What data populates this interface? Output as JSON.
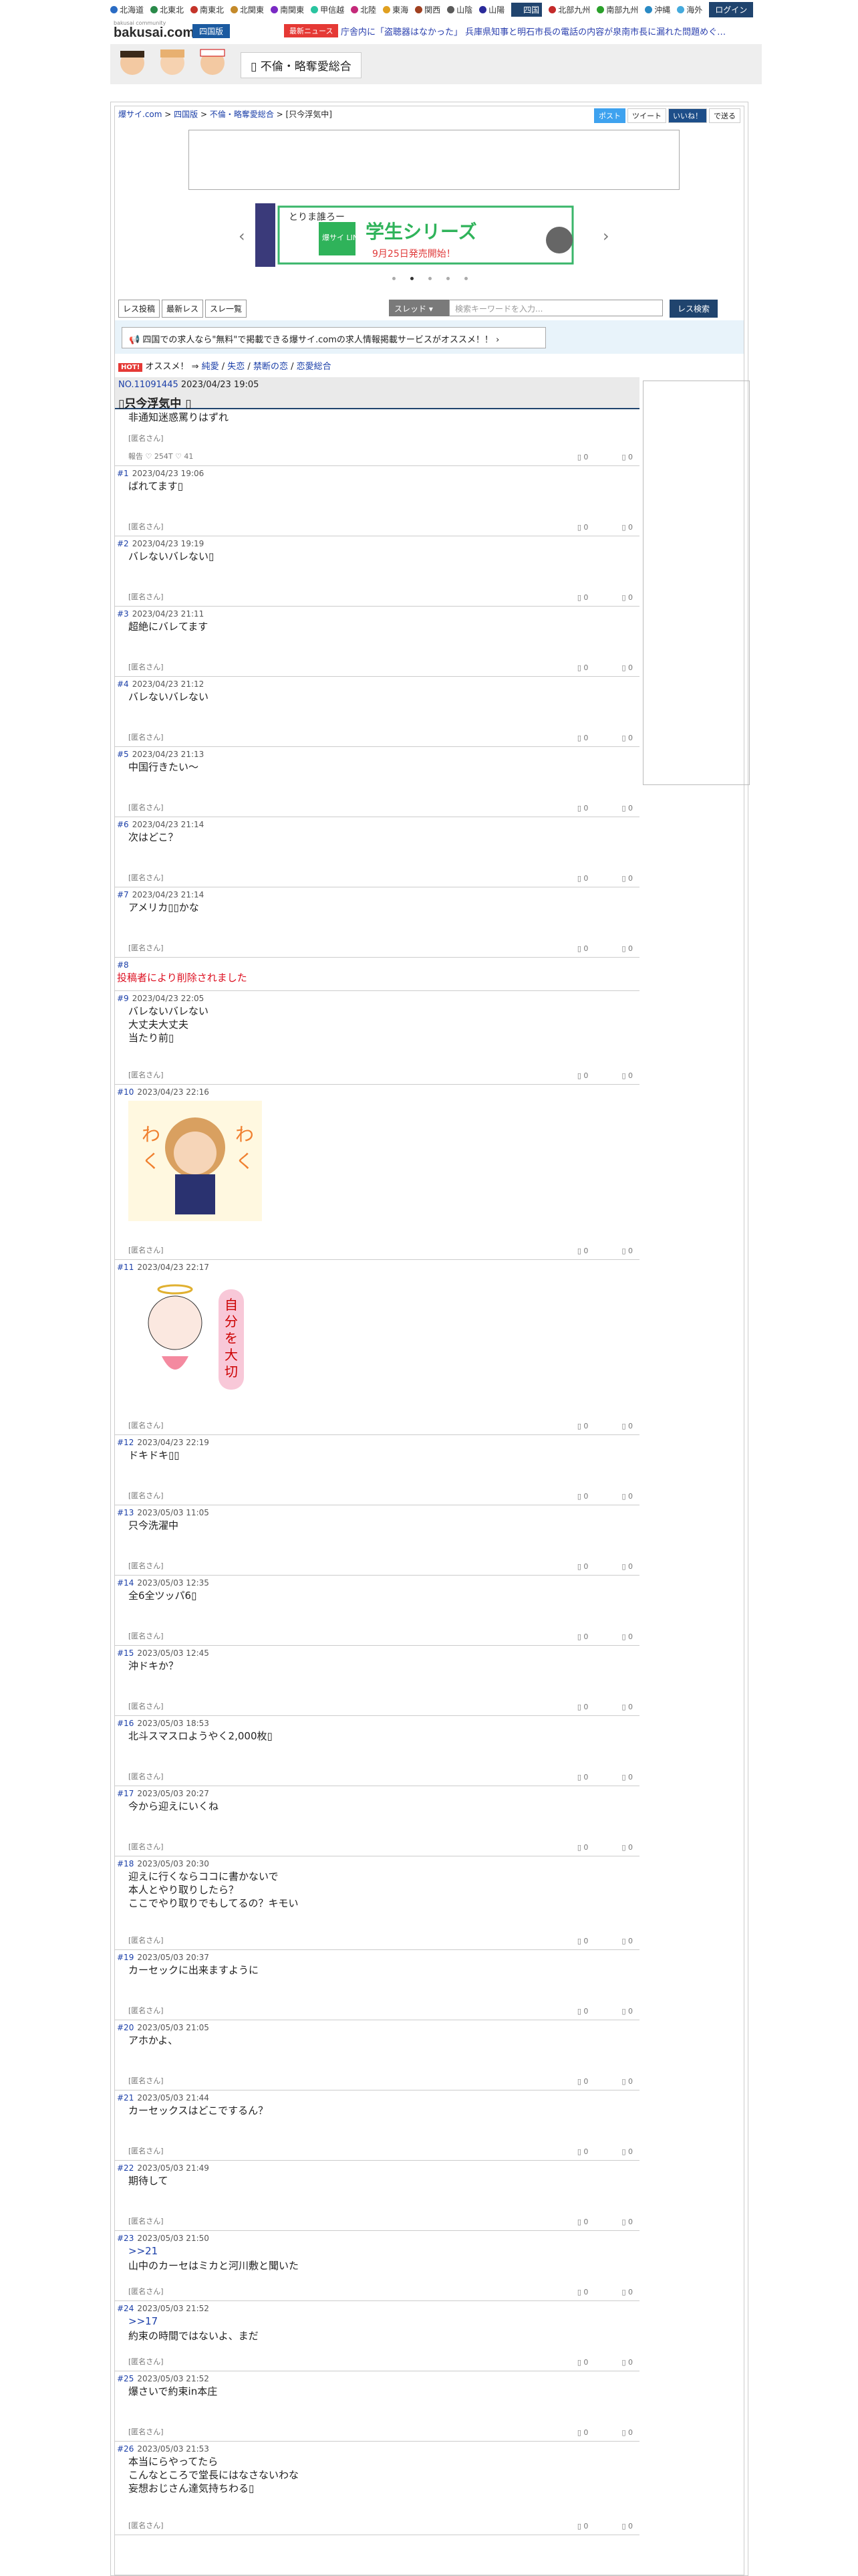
{
  "nav": {
    "regions": [
      "北海道",
      "北東北",
      "南東北",
      "北関東",
      "南関東",
      "甲信越",
      "北陸",
      "東海",
      "関西",
      "山陰",
      "山陽",
      "四国",
      "北部九州",
      "南部九州",
      "沖縄",
      "海外"
    ],
    "active_region": "四国",
    "login": "ログイン"
  },
  "header": {
    "logo_small": "bakusai community",
    "logo": "bakusai.com",
    "region_badge": "四国版",
    "news_badge": "最新ニュース",
    "ticker": "庁舎内に「盗聴器はなかった」 兵庫県知事と明石市長の電話の内容が泉南市長に漏れた問題めぐ…"
  },
  "category": {
    "title": "不倫・略奪愛総合"
  },
  "breadcrumb": {
    "b1": "爆サイ.com",
    "b2": "四国版",
    "b3": "不倫・略奪愛総合",
    "b4": "只今浮気中"
  },
  "share": {
    "twitter": "ポスト",
    "tweet": "ツイート",
    "line": "いいね！",
    "close": "で送る"
  },
  "banner": {
    "text_a": "とりま誰ろー",
    "text_b": "爆サイ LINE スタンプ",
    "text_c": "学生シリーズ",
    "text_d": "9月25日発売開始！"
  },
  "toolbar": {
    "post_reply": "レス投稿",
    "latest": "最新レス",
    "thread_list": "スレ一覧",
    "select": "スレッド",
    "search_placeholder": "検索キーワードを入力...",
    "search_btn": "レス検索"
  },
  "job_banner": "四国での求人なら\"無料\"で掲載できる爆サイ.comの求人情報掲載サービスがオススメ！！",
  "hot": {
    "badge": "HOT!",
    "label": "オススメ！",
    "arrow": "⇒",
    "links": [
      "純愛",
      "失恋",
      "禁断の恋",
      "恋愛総合"
    ]
  },
  "thread": {
    "no": "NO.11091445",
    "date": "2023/04/23 19:05",
    "title": "只今浮気中",
    "first_body": "非通知迷惑罵りはずれ",
    "first_author": "[匿名さん]",
    "first_stats": "報告  ♡ 254T  ♡ 41"
  },
  "posts": [
    {
      "n": "#1",
      "d": "2023/04/23 19:06",
      "b": "ばれてます▯",
      "a": "[匿名さん]"
    },
    {
      "n": "#2",
      "d": "2023/04/23 19:19",
      "b": "バレないバレない▯",
      "a": "[匿名さん]"
    },
    {
      "n": "#3",
      "d": "2023/04/23 21:11",
      "b": "超絶にバレてます",
      "a": "[匿名さん]"
    },
    {
      "n": "#4",
      "d": "2023/04/23 21:12",
      "b": "バレないバレない",
      "a": "[匿名さん]"
    },
    {
      "n": "#5",
      "d": "2023/04/23 21:13",
      "b": "中国行きたい〜",
      "a": "[匿名さん]"
    },
    {
      "n": "#6",
      "d": "2023/04/23 21:14",
      "b": "次はどこ？",
      "a": "[匿名さん]"
    },
    {
      "n": "#7",
      "d": "2023/04/23 21:14",
      "b": "アメリカ▯▯かな",
      "a": "[匿名さん]"
    },
    {
      "n": "#8",
      "d": "",
      "b": "投稿者により削除されました",
      "a": "",
      "del": true
    },
    {
      "n": "#9",
      "d": "2023/04/23 22:05",
      "b": "バレないバレない\n大丈夫大丈夫\n当たり前▯",
      "a": "[匿名さん]"
    },
    {
      "n": "#10",
      "d": "2023/04/23 22:16",
      "b": "",
      "a": "[匿名さん]",
      "sticker": "girl"
    },
    {
      "n": "#11",
      "d": "2023/04/23 22:17",
      "b": "",
      "a": "[匿名さん]",
      "sticker": "angel"
    },
    {
      "n": "#12",
      "d": "2023/04/23 22:19",
      "b": "ドキドキ▯▯",
      "a": "[匿名さん]"
    },
    {
      "n": "#13",
      "d": "2023/05/03 11:05",
      "b": "只今洗濯中",
      "a": "[匿名さん]"
    },
    {
      "n": "#14",
      "d": "2023/05/03 12:35",
      "b": "全6全ツッパ6▯",
      "a": "[匿名さん]"
    },
    {
      "n": "#15",
      "d": "2023/05/03 12:45",
      "b": "沖ドキか？",
      "a": "[匿名さん]"
    },
    {
      "n": "#16",
      "d": "2023/05/03 18:53",
      "b": "北斗スマスロようやく2,000枚▯",
      "a": "[匿名さん]"
    },
    {
      "n": "#17",
      "d": "2023/05/03 20:27",
      "b": "今から迎えにいくね",
      "a": "[匿名さん]"
    },
    {
      "n": "#18",
      "d": "2023/05/03 20:30",
      "b": "迎えに行くならココに書かないで\n本人とやり取りしたら？\nここでやり取りでもしてるの？キモい",
      "a": "[匿名さん]"
    },
    {
      "n": "#19",
      "d": "2023/05/03 20:37",
      "b": "カーセックに出来ますように",
      "a": "[匿名さん]"
    },
    {
      "n": "#20",
      "d": "2023/05/03 21:05",
      "b": "アホかよ、",
      "a": "[匿名さん]"
    },
    {
      "n": "#21",
      "d": "2023/05/03 21:44",
      "b": "カーセックスはどこでするん？",
      "a": "[匿名さん]"
    },
    {
      "n": "#22",
      "d": "2023/05/03 21:49",
      "b": "期待して",
      "a": "[匿名さん]"
    },
    {
      "n": "#23",
      "d": "2023/05/03 21:50",
      "b": "山中のカーセはミカと河川敷と聞いた",
      "anchor": ">>21",
      "a": "[匿名さん]"
    },
    {
      "n": "#24",
      "d": "2023/05/03 21:52",
      "b": "約束の時間ではないよ、まだ",
      "anchor": ">>17",
      "a": "[匿名さん]"
    },
    {
      "n": "#25",
      "d": "2023/05/03 21:52",
      "b": "爆さいで約束in本庄",
      "a": "[匿名さん]"
    },
    {
      "n": "#26",
      "d": "2023/05/03 21:53",
      "b": "本当にらやってたら\nこんなところで堂長にはなさないわな\n妄想おじさん達気持ちわる▯",
      "a": "[匿名さん]"
    }
  ],
  "vote_up": "▯ 0",
  "vote_down": "▯ 0",
  "colors": {
    "accent": "#20446e",
    "link": "#1a3ea8",
    "hot": "#e53935"
  }
}
